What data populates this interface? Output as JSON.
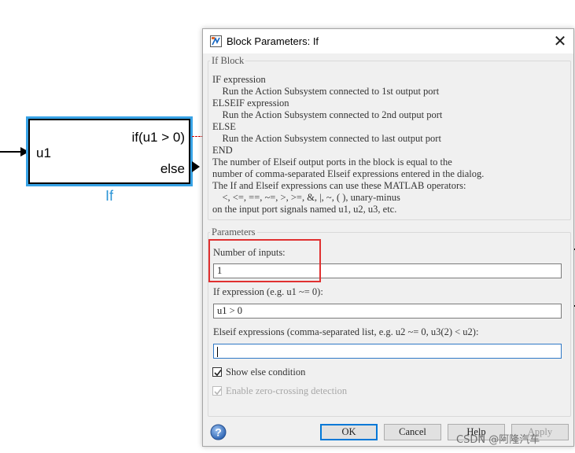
{
  "diagram": {
    "block": {
      "input_port": "u1",
      "output_if": "if(u1 > 0)",
      "output_else": "else",
      "name": "If"
    }
  },
  "dialog": {
    "title": "Block Parameters: If",
    "close_icon": "close-icon",
    "description_group": {
      "title": "If Block",
      "lines": [
        "IF expression",
        "    Run the Action Subsystem connected to 1st output port",
        "ELSEIF expression",
        "    Run the Action Subsystem connected to 2nd output port",
        "ELSE",
        "    Run the Action Subsystem connected to last output port",
        "END",
        "The number of Elseif output ports in the block is equal to the",
        "number of comma-separated Elseif expressions entered in the dialog.",
        "The If and Elseif expressions can use these MATLAB operators:",
        "    <, <=, ==, ~=, >, >=, &, |, ~, ( ), unary-minus",
        "on the input port signals named u1, u2, u3, etc."
      ]
    },
    "parameters_group": {
      "title": "Parameters",
      "num_inputs_label": "Number of inputs:",
      "num_inputs_value": "1",
      "if_expr_label": "If expression (e.g. u1 ~= 0):",
      "if_expr_value": "u1 > 0",
      "elseif_label": "Elseif expressions (comma-separated list, e.g. u2 ~= 0, u3(2) < u2):",
      "elseif_value": "",
      "show_else_label": "Show else condition",
      "show_else_checked": true,
      "zero_crossing_label": "Enable zero-crossing detection",
      "zero_crossing_checked": true,
      "zero_crossing_enabled": false
    },
    "buttons": {
      "ok": "OK",
      "cancel": "Cancel",
      "help": "Help",
      "apply": "Apply"
    },
    "help_icon": "help-question-icon"
  },
  "watermark": "CSDN @阿隆汽车",
  "colors": {
    "selection_blue": "#38a3e6",
    "highlight_red": "#e03030",
    "button_focus": "#0078d7"
  }
}
